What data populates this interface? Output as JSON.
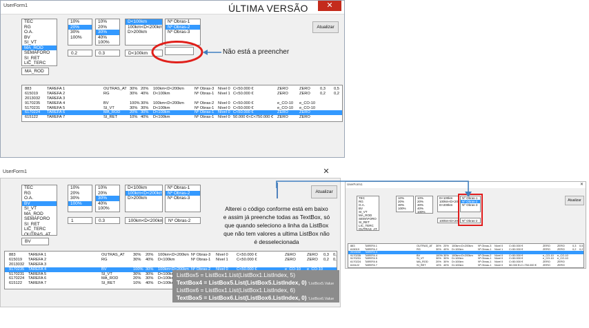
{
  "top": {
    "title": "UserForm1",
    "close": "✕",
    "heading": "ÚLTIMA VERSÃO",
    "callout": "Não está a preencher",
    "btn_atualizar": "Atualizar",
    "cat_items": [
      "TEC",
      "RG",
      "O.A.",
      "BV",
      "SI_VT",
      "MA_ROD",
      "SEMÁFORO",
      "SI_RET",
      "LIC_TERC",
      "OUTRAS_AT"
    ],
    "cat_sel": "MA_ROD",
    "pct1": [
      "10%",
      "20%",
      "30%",
      "100%"
    ],
    "pct2": [
      "10%",
      "20%",
      "30%",
      "40%",
      "100%"
    ],
    "dist": [
      "D<100km",
      "100km<D<200km",
      "D>200km"
    ],
    "obras": [
      "Nº Obras-1",
      "Nº Obras-2",
      "Nº Obras-3"
    ],
    "tb_cat": "MA_ROD",
    "tb_a": "0.2",
    "tb_b": "0.3",
    "tb_dist": "D<100km",
    "tb_obras": "",
    "rows": [
      [
        "883",
        "TAREFA 1",
        "OUTRAS_AT",
        "30%",
        "20%",
        "100km<D<200km",
        "Nº Obras-3",
        "Nível 0",
        "C<50.000 €",
        "ZERO",
        "ZERO",
        "0,3",
        "0,5"
      ],
      [
        "615019",
        "TAREFA 2",
        "RG",
        "30%",
        "40%",
        "D<100km",
        "Nº Obras-1",
        "Nível 1",
        "C<50.000 €",
        "ZERO",
        "ZERO",
        "0,2",
        "0,2"
      ],
      [
        "2013032",
        "TAREFA 3",
        "",
        "",
        "",
        "",
        "",
        "",
        "",
        "",
        "",
        "",
        ""
      ],
      [
        "9170235",
        "TAREFA 4",
        "BV",
        "100%",
        "30%",
        "100km<D<200km",
        "Nº Obras-2",
        "Nível 0",
        "C<50.000 €",
        "e_CO-10",
        "e_CO-10",
        "",
        ""
      ],
      [
        "5170231",
        "TAREFA 5",
        "SI_VT",
        "30%",
        "30%",
        "D<100km",
        "Nº Obras-1",
        "Nível 0",
        "C<50.000 €",
        "e_CO-10",
        "e_CO-10",
        "",
        ""
      ],
      [
        "6170224",
        "TAREFA 6",
        "MA_ROD",
        "20%",
        "30%",
        "D<100km",
        "Nº Obras-1",
        "Nível 0",
        "C<50.000 €",
        "ZERO",
        "ZERO",
        "",
        ""
      ],
      [
        "615122",
        "TAREFA 7",
        "SI_RET",
        "10%",
        "40%",
        "D<100km",
        "Nº Obras-1",
        "Nível 0",
        "50.000 €<C<750.000 €",
        "ZERO",
        "ZERO",
        "",
        ""
      ]
    ],
    "sel_row": 5
  },
  "bottom": {
    "title": "UserForm1",
    "close": "✕",
    "btn_atualizar": "Atualizar",
    "cat_items": [
      "TEC",
      "RG",
      "O.A.",
      "BV",
      "SI_VT",
      "MA_ROD",
      "SEMÁFORO",
      "SI_RET",
      "LIC_TERC",
      "OUTRAS_AT"
    ],
    "cat_sel": "BV",
    "pct1": [
      "10%",
      "20%",
      "30%",
      "100%"
    ],
    "pct1_sel": "100%",
    "pct2": [
      "10%",
      "20%",
      "30%",
      "40%",
      "100%"
    ],
    "pct2_sel": "30%",
    "dist": [
      "D<100km",
      "100km<D<200km",
      "D>200km"
    ],
    "dist_sel": "100km<D<200km",
    "obras": [
      "Nº Obras-1",
      "Nº Obras-2",
      "Nº Obras-3"
    ],
    "obras_sel": "Nº Obras-2",
    "tb_cat": "BV",
    "tb_a": "1",
    "tb_b": "0.3",
    "tb_dist": "100km<D<200km",
    "tb_obras": "Nº Obras-2",
    "rows": [
      [
        "883",
        "TAREFA 1",
        "OUTRAS_AT",
        "30%",
        "20%",
        "100km<D<200km",
        "Nº Obras-3",
        "Nível 0",
        "C<50.000 €",
        "ZERO",
        "ZERO",
        "0,3",
        "0,5"
      ],
      [
        "615019",
        "TAREFA 2",
        "RG",
        "30%",
        "40%",
        "D<100km",
        "Nº Obras-1",
        "Nível 1",
        "C<50.000 €",
        "ZERO",
        "ZERO",
        "0,2",
        "0,2"
      ],
      [
        "2013032",
        "TAREFA 3",
        "",
        "",
        "",
        "",
        "",
        "",
        "",
        "",
        "",
        "",
        ""
      ],
      [
        "9170235",
        "TAREFA 4",
        "BV",
        "100%",
        "30%",
        "100km<D<200km",
        "Nº Obras-2",
        "Nível 0",
        "C<50.000 €",
        "e_CO-10",
        "e_CO-10",
        "",
        ""
      ],
      [
        "5170231",
        "TAREFA 5",
        "SI_VT",
        "30%",
        "30%",
        "D<100km",
        "Nº Obras-1",
        "Nível 0",
        "C<50.000 €",
        "e_CO-10",
        "e_CO-10",
        "",
        ""
      ],
      [
        "6170224",
        "TAREFA 6",
        "MA_ROD",
        "20%",
        "30%",
        "D<100km",
        "Nº Obras-2",
        "Nível 0",
        "C<50.000 €",
        "ZERO",
        "ZERO",
        "",
        ""
      ],
      [
        "615122",
        "TAREFA 7",
        "SI_RET",
        "10%",
        "40%",
        "D<100km",
        "Nº Obras-1",
        "Nível 0",
        "50.000 €<C<750.000 €",
        "ZERO",
        "ZERO",
        "",
        ""
      ]
    ],
    "sel_row": 3,
    "explanation": [
      "Alterei o código conforme está em baixo",
      "e assim já preenche todas as TextBox, só",
      "que quando seleciono a linha da ListBox",
      "que não tem valores a ultima ListBox não",
      "é desselecionada"
    ],
    "code": [
      {
        "text": "ListBox5 = ListBox1.List(ListBox1.ListIndex, 5)",
        "comment": ""
      },
      {
        "text": "TextBox4 = ListBox5.List(ListBox5.ListIndex, 0)",
        "comment": "'ListBox5.Value"
      },
      {
        "text": "ListBox6 = ListBox1.List(ListBox1.ListIndex, 6)",
        "comment": ""
      },
      {
        "text": "TextBox5 = ListBox6.List(ListBox6.ListIndex, 0)",
        "comment": "'ListBox6.Value"
      }
    ]
  },
  "thumb": {
    "title": "UserForm1",
    "close": "✕",
    "btn_atualizar": "Atualizar",
    "cat_items": [
      "TEC",
      "RG",
      "O.A.",
      "BV",
      "SI_VT",
      "MA_ROD",
      "SEMÁFORO",
      "SI_RET",
      "LIC_TERC",
      "OUTRAS_AT"
    ],
    "pct1": [
      "10%",
      "20%",
      "30%",
      "100%"
    ],
    "pct2": [
      "10%",
      "20%",
      "30%",
      "40%",
      "100%"
    ],
    "dist": [
      "D<100km",
      "100km<D<200km",
      "D>200km"
    ],
    "obras": [
      "Nº Obras-1",
      "Nº Obras-2",
      "Nº Obras-3"
    ],
    "obras_sel": "Nº Obras-2",
    "tb_dist": "100km<D<200km",
    "tb_obras": "Nº Obras-2",
    "rows": [
      [
        "883",
        "TAREFA 1",
        "OUTRAS_AT",
        "30%",
        "20%",
        "100km<D<200km",
        "Nº Obras-3",
        "Nível 0",
        "C<50.000 €",
        "ZERO",
        "ZERO",
        "0,3",
        "0,5"
      ],
      [
        "615019",
        "TAREFA 2",
        "RG",
        "30%",
        "40%",
        "D<100km",
        "Nº Obras-1",
        "Nível 1",
        "C<50.000 €",
        "ZERO",
        "ZERO",
        "0,2",
        "0,2"
      ],
      [
        "2013032",
        "TAREFA 3",
        "",
        "",
        "",
        "",
        "",
        "",
        "",
        "",
        "",
        "",
        ""
      ],
      [
        "9170235",
        "TAREFA 4",
        "BV",
        "100%",
        "30%",
        "100km<D<200km",
        "Nº Obras-2",
        "Nível 0",
        "C<50.000 €",
        "e_CO-10",
        "e_CO-10",
        "",
        ""
      ],
      [
        "5170231",
        "TAREFA 5",
        "SI_VT",
        "30%",
        "30%",
        "D<100km",
        "Nº Obras-1",
        "Nível 0",
        "C<50.000 €",
        "e_CO-10",
        "e_CO-10",
        "",
        ""
      ],
      [
        "6170224",
        "TAREFA 6",
        "MA_ROD",
        "20%",
        "30%",
        "D<100km",
        "Nº Obras-1",
        "Nível 0",
        "C<50.000 €",
        "ZERO",
        "ZERO",
        "",
        ""
      ],
      [
        "615122",
        "TAREFA 7",
        "SI_RET",
        "10%",
        "40%",
        "D<100km",
        "Nº Obras-1",
        "Nível 0",
        "50.000 €<C<750.000 €",
        "ZERO",
        "ZERO",
        "",
        ""
      ]
    ],
    "sel_row": 2
  },
  "colors": {
    "selection": "#3399ff",
    "close_red": "#c42b1c",
    "callout_red": "#e0201b",
    "highlight_red": "#e01b1b",
    "arrow_blue": "#3f7fbf",
    "code_bg": "#8c8c8c"
  }
}
